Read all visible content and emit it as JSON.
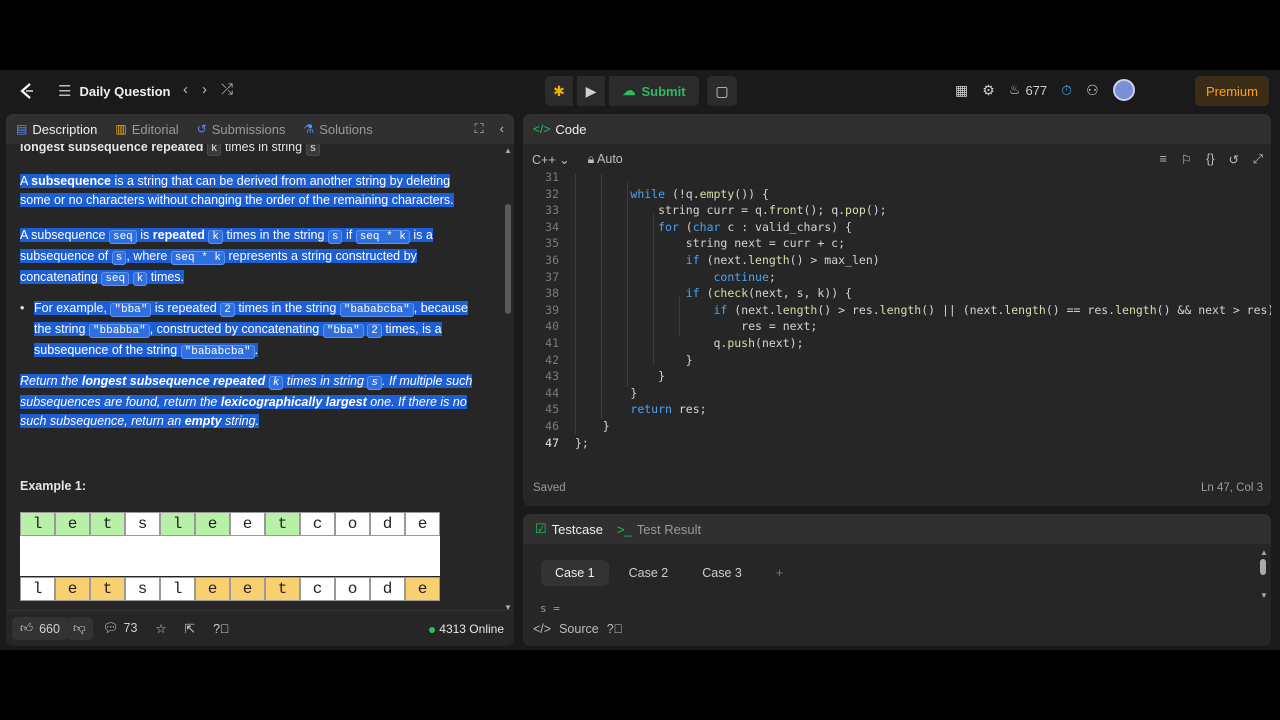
{
  "topnav": {
    "title": "Daily Question",
    "submit_label": "Submit",
    "streak_count": "677",
    "premium_label": "Premium"
  },
  "left_tabs": [
    "Description",
    "Editorial",
    "Submissions",
    "Solutions"
  ],
  "description": {
    "top_line_prefix": "longest subsequence repeated",
    "top_line_k": "k",
    "top_line_mid": "times in string",
    "top_line_s": "s",
    "p1_a": "A ",
    "p1_bold": "subsequence",
    "p1_b": " is a string that can be derived from another string by deleting some or no characters without changing the order of the remaining characters.",
    "p2_a": "A subsequence ",
    "p2_seq": "seq",
    "p2_b": " is ",
    "p2_bold": "repeated",
    "p2_k": "k",
    "p2_c": " times in the string ",
    "p2_s": "s",
    "p2_d": " if ",
    "p2_seqk": "seq * k",
    "p2_e": " is a subsequence of ",
    "p2_s2": "s",
    "p2_f": ", where ",
    "p2_seqk2": "seq * k",
    "p2_g": " represents a string constructed by concatenating ",
    "p2_seq2": "seq",
    "p2_k2": "k",
    "p2_h": " times.",
    "bullet_a": "For example, ",
    "bullet_bba": "\"bba\"",
    "bullet_b": " is repeated ",
    "bullet_2": "2",
    "bullet_c": " times in the string ",
    "bullet_bababcba": "\"bababcba\"",
    "bullet_d": ", because the string ",
    "bullet_bbabba": "\"bbabba\"",
    "bullet_e": ", constructed by concatenating ",
    "bullet_bba2": "\"bba\"",
    "bullet_2b": "2",
    "bullet_f": " times, is a subsequence of the string ",
    "bullet_bababcba2": "\"bababcba\"",
    "bullet_g": ".",
    "p3_a": "Return the ",
    "p3_bold1": "longest subsequence repeated",
    "p3_k": "k",
    "p3_b": " times in string ",
    "p3_s": "s",
    "p3_c": ". If multiple such subsequences are found, return the ",
    "p3_bold2": "lexicographically largest",
    "p3_d": " one. If there is no such subsequence, return an ",
    "p3_bold3": "empty",
    "p3_e": " string.",
    "example_title": "Example 1:",
    "row1": [
      "l",
      "e",
      "t",
      "s",
      "l",
      "e",
      "e",
      "t",
      "c",
      "o",
      "d",
      "e"
    ],
    "row1_colors": [
      "g",
      "g",
      "g",
      "w",
      "g",
      "g",
      "w",
      "g",
      "w",
      "w",
      "w",
      "w"
    ],
    "row2": [
      "l",
      "e",
      "t",
      "s",
      "l",
      "e",
      "e",
      "t",
      "c",
      "o",
      "d",
      "e"
    ],
    "row2_colors": [
      "w",
      "y",
      "y",
      "w",
      "w",
      "y",
      "y",
      "y",
      "w",
      "w",
      "w",
      "y"
    ]
  },
  "left_footer": {
    "likes": "660",
    "comments": "73",
    "online": "4313 Online"
  },
  "code_panel": {
    "title": "Code",
    "language": "C++",
    "mode": "Auto",
    "saved": "Saved",
    "cursor": "Ln 47, Col 3",
    "lines": [
      {
        "n": "31",
        "text": ""
      },
      {
        "n": "32",
        "text": "        while (!q.empty()) {"
      },
      {
        "n": "33",
        "text": "            string curr = q.front(); q.pop();"
      },
      {
        "n": "34",
        "text": "            for (char c : valid_chars) {"
      },
      {
        "n": "35",
        "text": "                string next = curr + c;"
      },
      {
        "n": "36",
        "text": "                if (next.length() > max_len)"
      },
      {
        "n": "37",
        "text": "                    continue;"
      },
      {
        "n": "38",
        "text": "                if (check(next, s, k)) {"
      },
      {
        "n": "39",
        "text": "                    if (next.length() > res.length() || (next.length() == res.length() && next > res))"
      },
      {
        "n": "40",
        "text": "                        res = next;"
      },
      {
        "n": "41",
        "text": "                    q.push(next);"
      },
      {
        "n": "42",
        "text": "                }"
      },
      {
        "n": "43",
        "text": "            }"
      },
      {
        "n": "44",
        "text": "        }"
      },
      {
        "n": "45",
        "text": "        return res;"
      },
      {
        "n": "46",
        "text": "    }"
      },
      {
        "n": "47",
        "text": "};"
      }
    ]
  },
  "test_panel": {
    "tab_testcase": "Testcase",
    "tab_result": "Test Result",
    "cases": [
      "Case 1",
      "Case 2",
      "Case 3"
    ],
    "add": "+",
    "var_label": "s =",
    "source": "Source"
  }
}
